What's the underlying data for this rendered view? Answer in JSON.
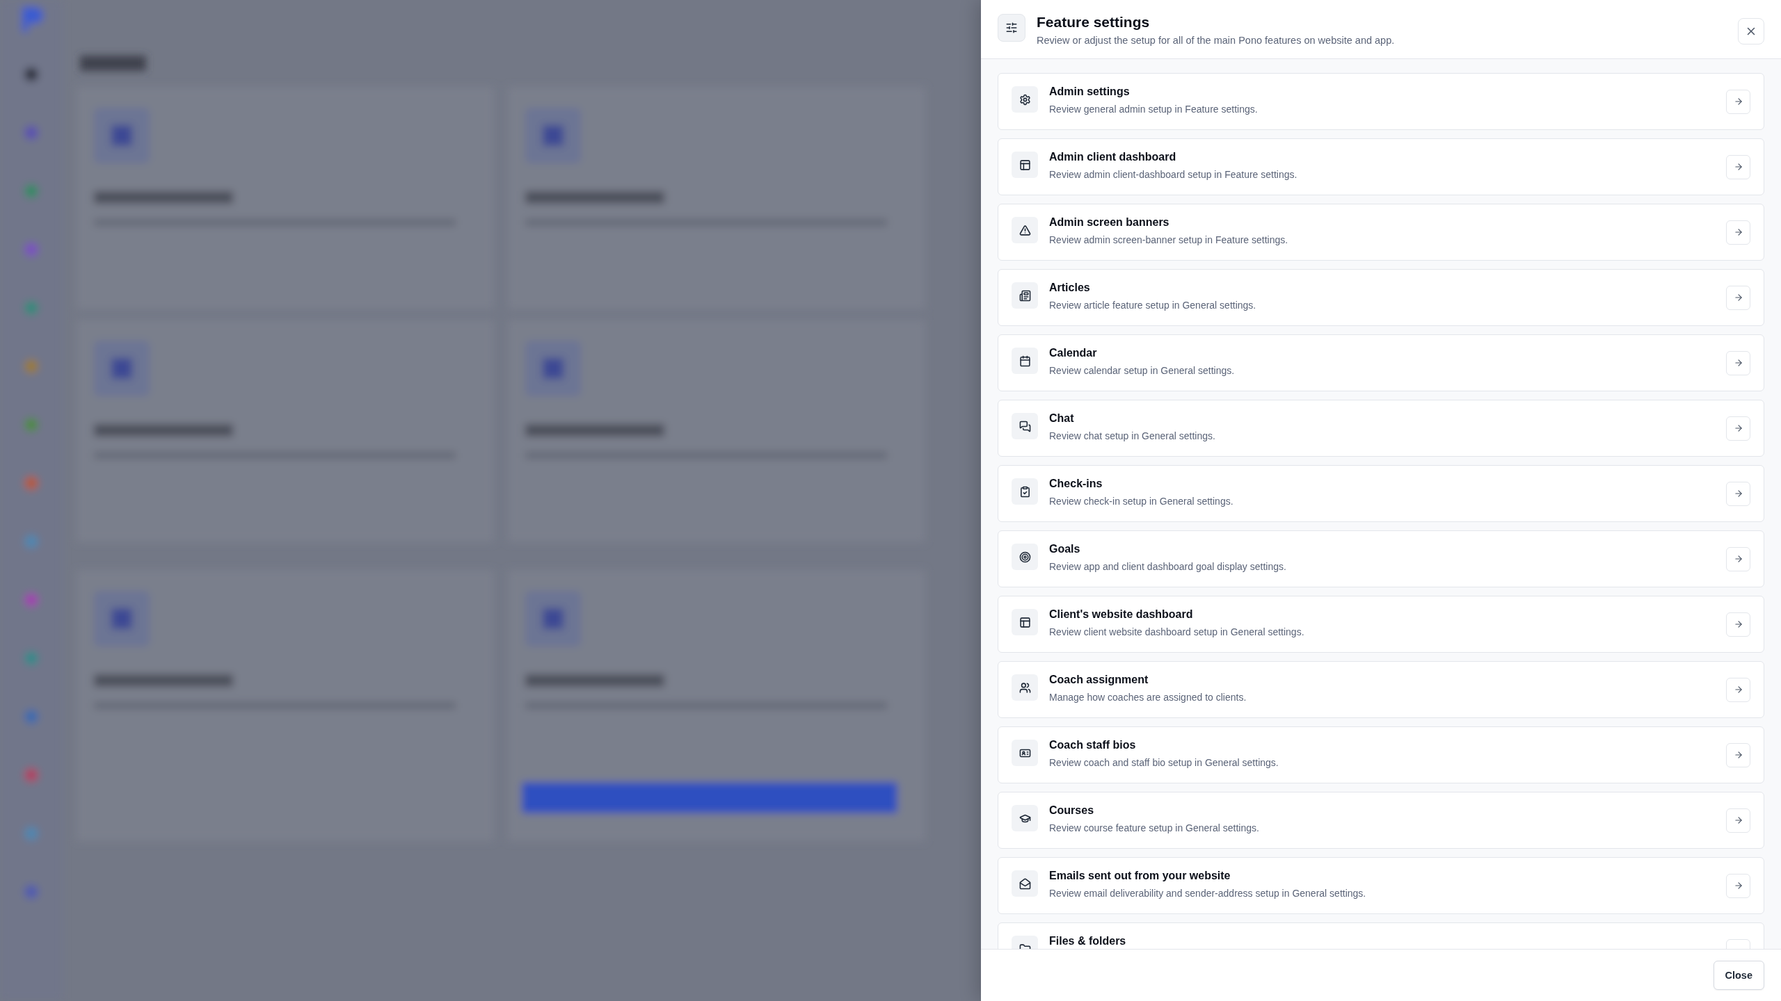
{
  "panel": {
    "title": "Feature settings",
    "subtitle": "Review or adjust the setup for all of the main Pono features on website and app.",
    "items": [
      {
        "title": "Admin settings",
        "description": "Review general admin setup in Feature settings."
      },
      {
        "title": "Admin client dashboard",
        "description": "Review admin client-dashboard setup in Feature settings."
      },
      {
        "title": "Admin screen banners",
        "description": "Review admin screen-banner setup in Feature settings."
      },
      {
        "title": "Articles",
        "description": "Review article feature setup in General settings."
      },
      {
        "title": "Calendar",
        "description": "Review calendar setup in General settings."
      },
      {
        "title": "Chat",
        "description": "Review chat setup in General settings."
      },
      {
        "title": "Check-ins",
        "description": "Review check-in setup in General settings."
      },
      {
        "title": "Goals",
        "description": "Review app and client dashboard goal display settings."
      },
      {
        "title": "Client's website dashboard",
        "description": "Review client website dashboard setup in General settings."
      },
      {
        "title": "Coach assignment",
        "description": "Manage how coaches are assigned to clients."
      },
      {
        "title": "Coach staff bios",
        "description": "Review coach and staff bio setup in General settings."
      },
      {
        "title": "Courses",
        "description": "Review course feature setup in General settings."
      },
      {
        "title": "Emails sent out from your website",
        "description": "Review email deliverability and sender-address setup in General settings."
      },
      {
        "title": "Files & folders"
      }
    ],
    "footer_button": "Close"
  }
}
